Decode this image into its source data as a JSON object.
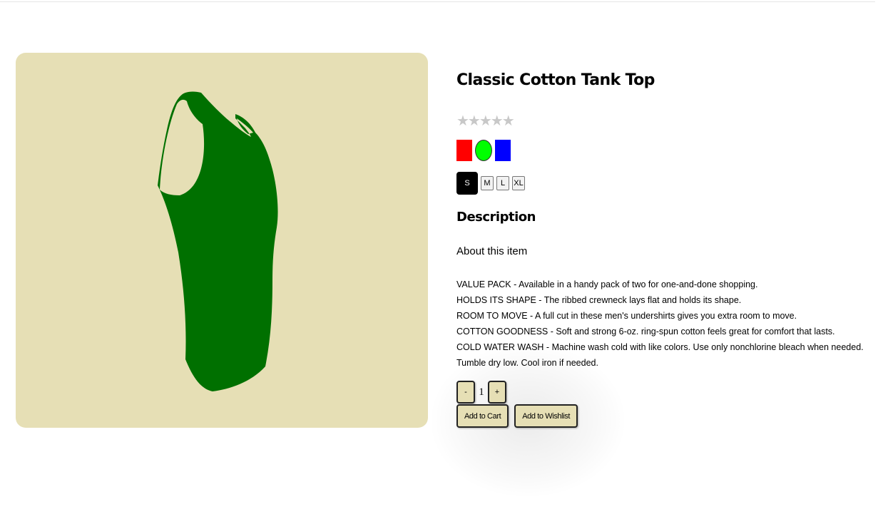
{
  "product": {
    "title": "Classic Cotton Tank Top",
    "rating_display": "★★★★★",
    "rating_value": 0,
    "rating_max": 5,
    "image_icon": "tank-top-image",
    "image_bg_color": "#e6dfb5",
    "garment_color": "#007000"
  },
  "colors": [
    {
      "name": "red",
      "hex": "#ff0000"
    },
    {
      "name": "green",
      "hex": "#00ff00"
    },
    {
      "name": "blue",
      "hex": "#0000ff"
    }
  ],
  "sizes": [
    {
      "label": "S",
      "selected": true
    },
    {
      "label": "M",
      "selected": false
    },
    {
      "label": "L",
      "selected": false
    },
    {
      "label": "XL",
      "selected": false
    }
  ],
  "description": {
    "heading": "Description",
    "about": "About this item",
    "bullets": [
      "VALUE PACK - Available in a handy pack of two for one-and-done shopping.",
      "HOLDS ITS SHAPE - The ribbed crewneck lays flat and holds its shape.",
      "ROOM TO MOVE - A full cut in these men's undershirts gives you extra room to move.",
      "COTTON GOODNESS - Soft and strong 6-oz. ring-spun cotton feels great for comfort that lasts.",
      "COLD WATER WASH - Machine wash cold with like colors. Use only nonchlorine bleach when needed.",
      "Tumble dry low. Cool iron if needed."
    ]
  },
  "quantity": {
    "decrement_label": "-",
    "value": "1",
    "increment_label": "+"
  },
  "actions": {
    "add_to_cart": "Add to Cart",
    "add_to_wishlist": "Add to Wishlist"
  },
  "theme": {
    "button_bg": "#e6dfb5",
    "selected_size_bg": "#000000"
  }
}
